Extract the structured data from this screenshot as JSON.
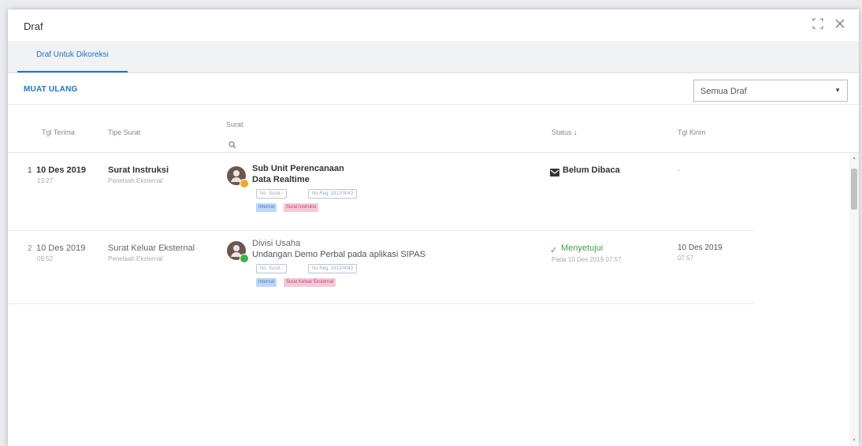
{
  "window": {
    "title": "Draf",
    "maximize_icon": "maximize-icon",
    "close_icon": "close-icon"
  },
  "tabs": [
    {
      "label": "Draf Untuk Dikoreksi",
      "active": true
    }
  ],
  "toolbar": {
    "reload_label": "MUAT ULANG",
    "filter": {
      "selected": "Semua Draf"
    }
  },
  "table": {
    "columns": {
      "tgl_terima": "Tgl Terima",
      "tipe_surat": "Tipe Surat",
      "surat": "Surat",
      "status": "Status",
      "tgl_kirim": "Tgl Kirim"
    },
    "rows": [
      {
        "num": "1",
        "date": "10 Des 2019",
        "time": "13:27",
        "type": "Surat Instruksi",
        "type_sub": "Penelaah Eksternal",
        "sender": "Sub Unit Perencanaan",
        "subject": "Data Realtime",
        "no_surat": "No. Surat -",
        "no_reg": "No.Reg: 1912/0043",
        "tag1": "Internal",
        "tag2": "Surat Instruksi",
        "status": "Belum Dibaca",
        "status_sub": "",
        "kirim_date": "-",
        "kirim_time": "",
        "badge_color": "#f0a825",
        "unread": true
      },
      {
        "num": "2",
        "date": "10 Des 2019",
        "time": "09:52",
        "type": "Surat Keluar Eksternal",
        "type_sub": "Penelaah Eksternal",
        "sender": "Divisi Usaha",
        "subject": "Undangan Demo Perbal pada aplikasi SIPAS",
        "no_surat": "No. Surat -",
        "no_reg": "No.Reg: 1912/0043",
        "tag1": "Internal",
        "tag2": "Surat Keluar Eksternal",
        "status": "Menyetujui",
        "status_sub": "Pada 10 Des 2019 07:57",
        "kirim_date": "10 Des 2019",
        "kirim_time": "07:57",
        "badge_color": "#3cb14a",
        "unread": false
      }
    ]
  },
  "colors": {
    "accent": "#1976d2",
    "approve": "#43a047"
  }
}
